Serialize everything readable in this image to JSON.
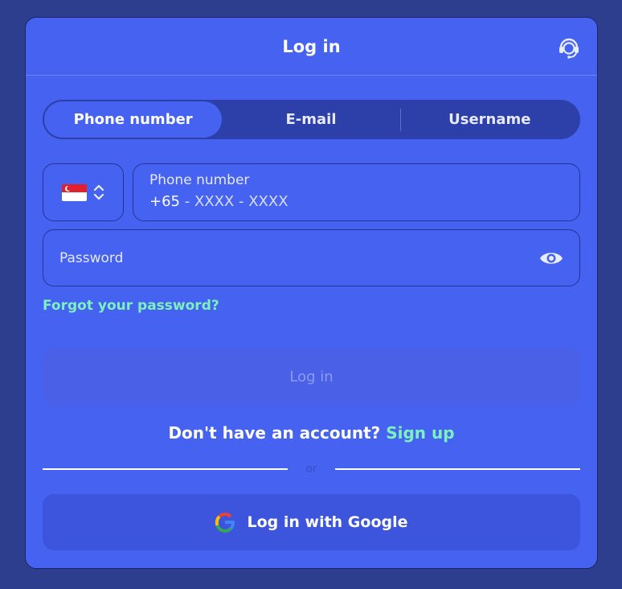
{
  "header": {
    "title": "Log in",
    "support_icon": "headset-support-icon"
  },
  "tabs": [
    {
      "label": "Phone number",
      "active": true
    },
    {
      "label": "E-mail",
      "active": false
    },
    {
      "label": "Username",
      "active": false
    }
  ],
  "country": {
    "flag": "singapore-flag-icon",
    "selector_icon": "chevron-up-down-icon"
  },
  "phone": {
    "label": "Phone number",
    "code": "+65",
    "mask": " - XXXX - XXXX"
  },
  "password": {
    "placeholder": "Password",
    "toggle_icon": "eye-icon"
  },
  "forgot_password": "Forgot your password?",
  "login_button": "Log in",
  "signup": {
    "prompt": "Don't have an account?",
    "link": "Sign up"
  },
  "divider": "or",
  "google": {
    "label": "Log in with Google",
    "icon": "google-icon"
  },
  "colors": {
    "accent_green": "#7cf0bd",
    "modal_bg": "#4563f0",
    "page_bg": "#2e3e8f"
  }
}
